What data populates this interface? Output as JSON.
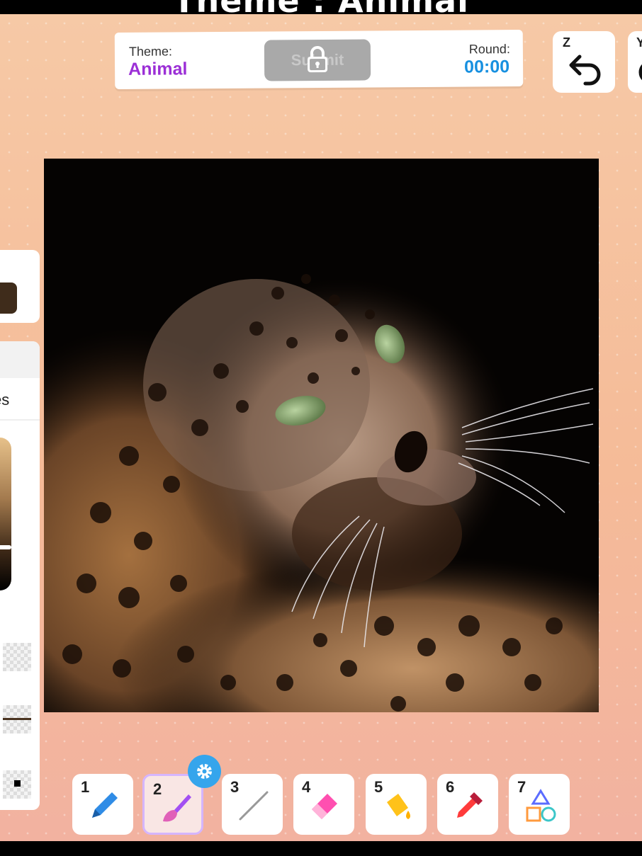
{
  "top_title": "Theme : Animal",
  "header": {
    "theme_label": "Theme:",
    "theme_value": "Animal",
    "submit_label": "Submit",
    "submit_locked": true,
    "round_label": "Round:",
    "round_timer": "00:00"
  },
  "history": {
    "undo_key": "Z",
    "redo_key": "Y"
  },
  "side_panel": {
    "current_color": "#3f2c1b",
    "tab_label_partial": "es",
    "brightness_level": 0.72
  },
  "toolbar": {
    "tools": [
      {
        "key": "1",
        "name": "pencil"
      },
      {
        "key": "2",
        "name": "brush",
        "active": true
      },
      {
        "key": "3",
        "name": "line"
      },
      {
        "key": "4",
        "name": "eraser"
      },
      {
        "key": "5",
        "name": "fill-bucket"
      },
      {
        "key": "6",
        "name": "eyedropper"
      },
      {
        "key": "7",
        "name": "shapes"
      }
    ]
  },
  "colors": {
    "theme_accent": "#9b2fd6",
    "timer_accent": "#1790e0",
    "settings_badge": "#35a5ec"
  }
}
